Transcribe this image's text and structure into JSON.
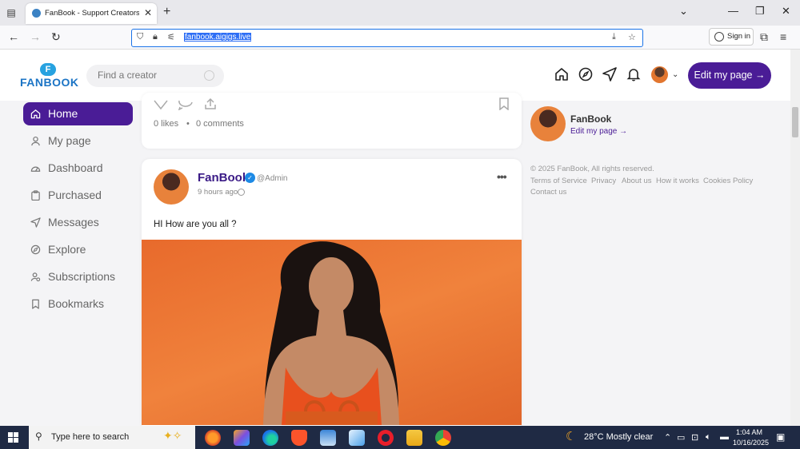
{
  "browser": {
    "tab_title": "FanBook - Support Creators Co",
    "url": "fanbook.aigigs.live",
    "sign_in": "Sign in"
  },
  "site": {
    "logo_letter": "F",
    "logo_text": "FANBOOK",
    "search_placeholder": "Find a creator",
    "edit_button": "Edit my page →"
  },
  "sidebar": {
    "items": [
      {
        "label": "Home",
        "icon": "home-icon",
        "active": true
      },
      {
        "label": "My page",
        "icon": "user-icon"
      },
      {
        "label": "Dashboard",
        "icon": "dashboard-icon"
      },
      {
        "label": "Purchased",
        "icon": "clipboard-icon"
      },
      {
        "label": "Messages",
        "icon": "send-icon"
      },
      {
        "label": "Explore",
        "icon": "compass-icon"
      },
      {
        "label": "Subscriptions",
        "icon": "subscriptions-icon"
      },
      {
        "label": "Bookmarks",
        "icon": "bookmark-icon"
      }
    ]
  },
  "prev_post": {
    "likes": "0 likes",
    "comments": "0 comments"
  },
  "post": {
    "author": "FanBook",
    "handle": "@Admin",
    "time": "9 hours ago",
    "text": "HI How are you all ?"
  },
  "right_column": {
    "name": "FanBook",
    "edit_link": "Edit my page →",
    "copyright": "© 2025 FanBook, All rights reserved.",
    "links": [
      "Terms of Service",
      "Privacy",
      "About us",
      "How it works",
      "Cookies Policy",
      "Contact us"
    ]
  },
  "taskbar": {
    "search": "Type here to search",
    "weather": "28°C  Mostly clear",
    "time": "1:04 AM",
    "date": "10/16/2025"
  },
  "colors": {
    "brand_purple": "#4a1c96",
    "logo_blue": "#1b74c5"
  }
}
